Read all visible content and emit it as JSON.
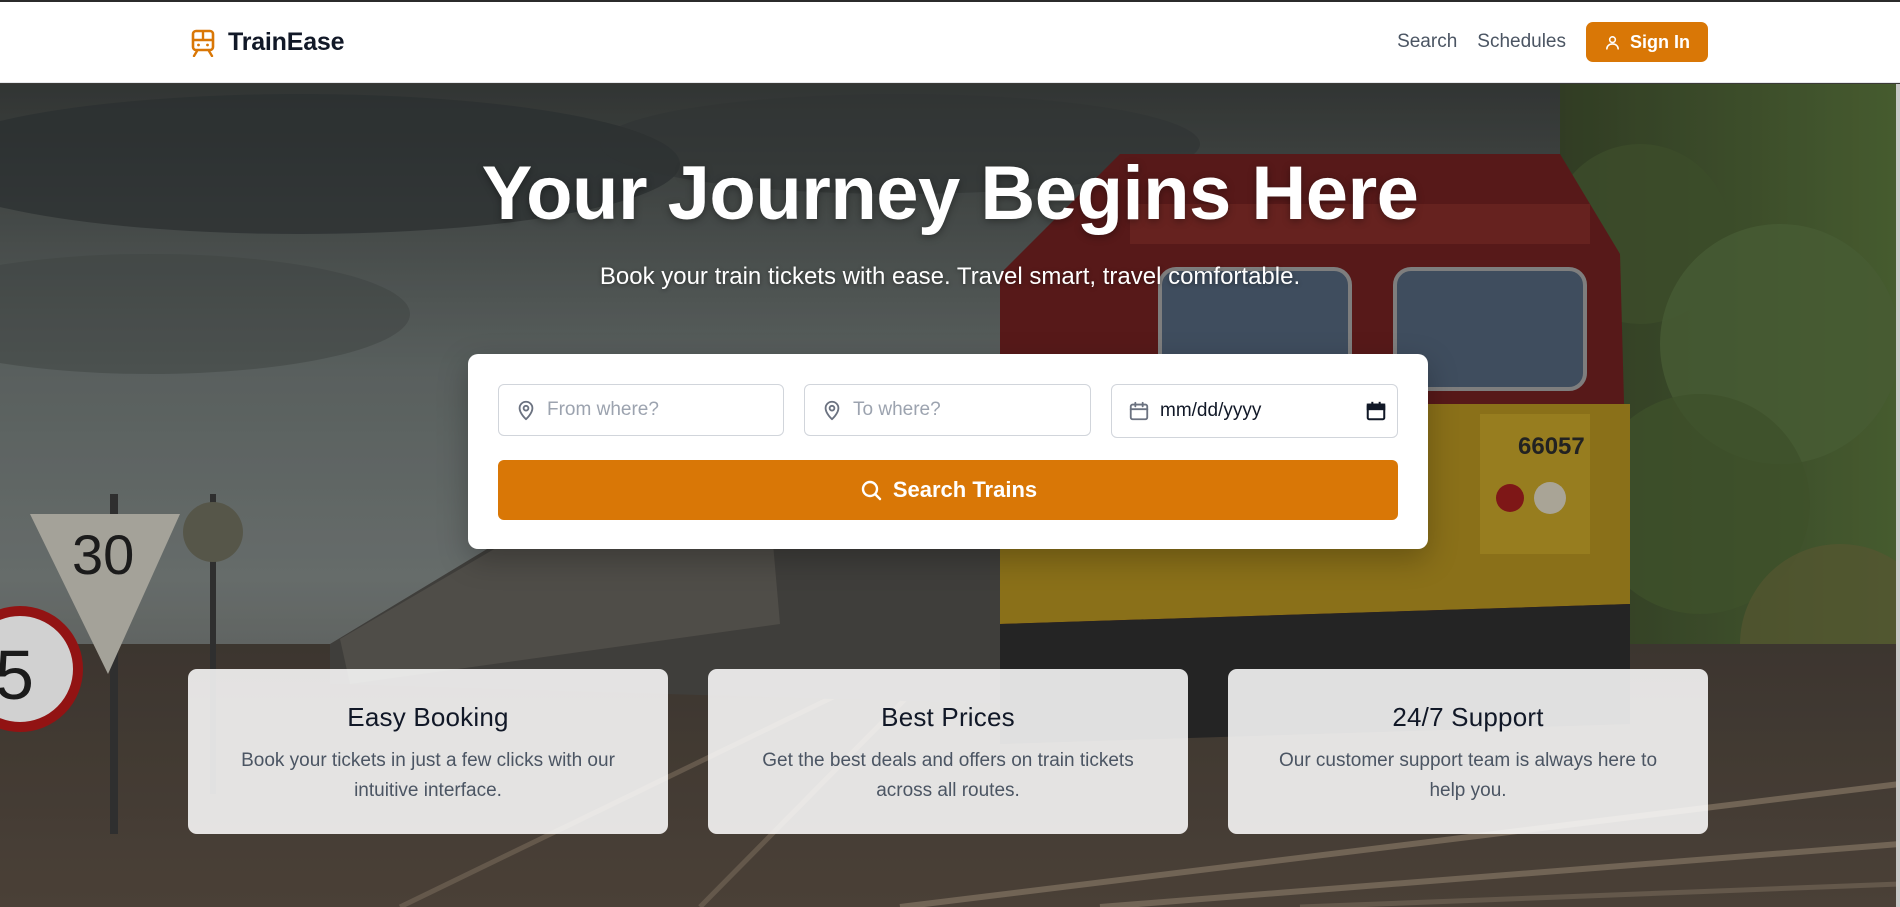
{
  "brand": {
    "name": "TrainEase",
    "icon": "train-icon",
    "accent": "#d97706"
  },
  "nav": {
    "links": [
      "Search",
      "Schedules"
    ],
    "signin_label": "Sign In",
    "signin_icon": "user-icon"
  },
  "hero": {
    "title": "Your Journey Begins Here",
    "subtitle": "Book your train tickets with ease. Travel smart, travel comfortable.",
    "background": "train-on-tracks-photo"
  },
  "search": {
    "from_placeholder": "From where?",
    "to_placeholder": "To where?",
    "date_value": "mm/dd/yyyy",
    "button_label": "Search Trains",
    "from_icon": "map-pin-icon",
    "to_icon": "map-pin-icon",
    "date_icon": "calendar-icon",
    "button_icon": "search-icon"
  },
  "features": [
    {
      "title": "Easy Booking",
      "line1": "Book your tickets in just a few clicks with our",
      "line2": "intuitive interface."
    },
    {
      "title": "Best Prices",
      "line1": "Get the best deals and offers on train tickets",
      "line2": "across all routes."
    },
    {
      "title": "24/7 Support",
      "line1": "Our customer support team is always here to",
      "line2": "help you."
    }
  ]
}
